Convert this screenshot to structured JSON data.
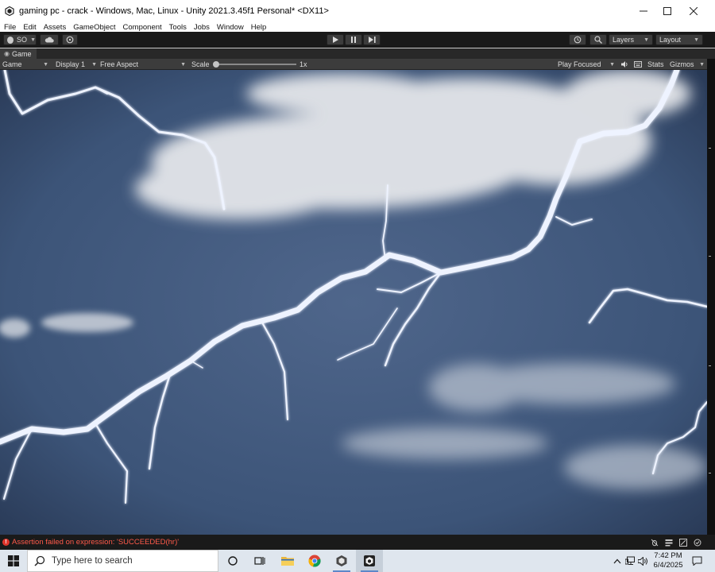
{
  "window": {
    "title": "gaming pc - crack - Windows, Mac, Linux - Unity 2021.3.45f1 Personal* <DX11>",
    "minimize_icon": "minimize-icon",
    "maximize_icon": "maximize-icon",
    "close_icon": "close-icon"
  },
  "menu": {
    "items": [
      "File",
      "Edit",
      "Assets",
      "GameObject",
      "Component",
      "Tools",
      "Jobs",
      "Window",
      "Help"
    ]
  },
  "toolbar": {
    "account_label": "SO",
    "layers_label": "Layers",
    "layout_label": "Layout"
  },
  "tab": {
    "label": "Game"
  },
  "game_toolbar": {
    "view_mode": "Game",
    "display": "Display 1",
    "aspect": "Free Aspect",
    "scale_label": "Scale",
    "scale_value": "1x",
    "scale_fraction": 0.0,
    "play_mode": "Play Focused",
    "stats_label": "Stats",
    "gizmos_label": "Gizmos"
  },
  "console": {
    "message": "Assertion failed on expression: 'SUCCEEDED(hr)'"
  },
  "taskbar": {
    "search_placeholder": "Type here to search",
    "time": "7:42 PM",
    "date": "6/4/2025"
  },
  "colors": {
    "sky": "#3e567c",
    "cloud": "#e6e8ec",
    "lightning": "#eef3ff",
    "error_text": "#ff5a4a"
  }
}
